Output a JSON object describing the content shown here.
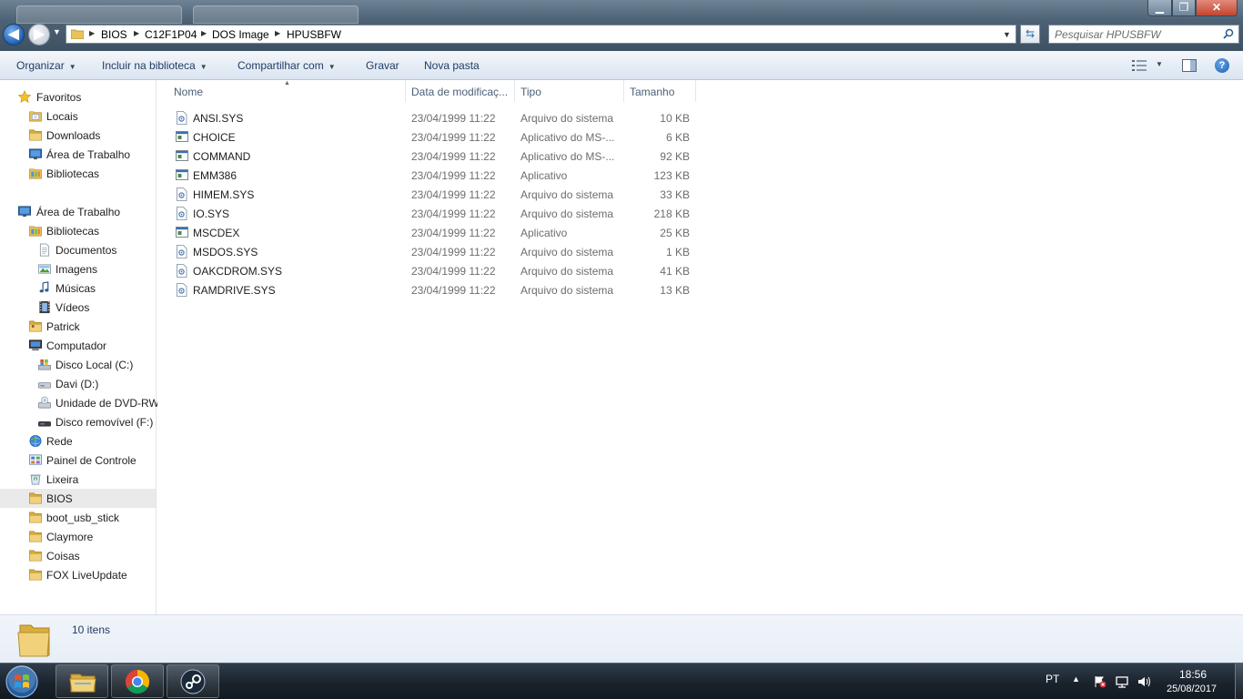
{
  "window": {
    "minimize_glyph": "▁",
    "maximize_glyph": "❐",
    "close_glyph": "✕"
  },
  "address": {
    "breadcrumbs": [
      "BIOS",
      "C12F1P04",
      "DOS Image",
      "HPUSBFW"
    ],
    "search_placeholder": "Pesquisar HPUSBFW"
  },
  "toolbar": {
    "organize": "Organizar",
    "include_in_library": "Incluir na biblioteca",
    "share_with": "Compartilhar com",
    "burn": "Gravar",
    "new_folder": "Nova pasta"
  },
  "nav": {
    "items": [
      {
        "label": "Favoritos",
        "icon": "star-icon"
      },
      {
        "label": "Locais",
        "icon": "recent-places-icon"
      },
      {
        "label": "Downloads",
        "icon": "folder-icon"
      },
      {
        "label": "Área de Trabalho",
        "icon": "desktop-icon"
      },
      {
        "label": "Bibliotecas",
        "icon": "libraries-icon"
      },
      {
        "label": "Área de Trabalho",
        "icon": "desktop-icon"
      },
      {
        "label": "Bibliotecas",
        "icon": "libraries-icon"
      },
      {
        "label": "Documentos",
        "icon": "documents-icon"
      },
      {
        "label": "Imagens",
        "icon": "pictures-icon"
      },
      {
        "label": "Músicas",
        "icon": "music-icon"
      },
      {
        "label": "Vídeos",
        "icon": "videos-icon"
      },
      {
        "label": "Patrick",
        "icon": "user-folder-icon"
      },
      {
        "label": "Computador",
        "icon": "computer-icon"
      },
      {
        "label": "Disco Local (C:)",
        "icon": "local-disk-icon"
      },
      {
        "label": "Davi (D:)",
        "icon": "drive-icon"
      },
      {
        "label": "Unidade de DVD-RW",
        "icon": "dvd-drive-icon"
      },
      {
        "label": "Disco removível (F:)",
        "icon": "removable-drive-icon"
      },
      {
        "label": "Rede",
        "icon": "network-icon"
      },
      {
        "label": "Painel de Controle",
        "icon": "control-panel-icon"
      },
      {
        "label": "Lixeira",
        "icon": "recycle-bin-icon"
      },
      {
        "label": "BIOS",
        "icon": "folder-icon"
      },
      {
        "label": "boot_usb_stick",
        "icon": "folder-icon"
      },
      {
        "label": "Claymore",
        "icon": "folder-icon"
      },
      {
        "label": "Coisas",
        "icon": "folder-icon"
      },
      {
        "label": "FOX LiveUpdate",
        "icon": "folder-icon"
      }
    ]
  },
  "columns": {
    "name": "Nome",
    "date": "Data de modificaç...",
    "type": "Tipo",
    "size": "Tamanho"
  },
  "files": [
    {
      "name": "ANSI.SYS",
      "date": "23/04/1999 11:22",
      "type": "Arquivo do sistema",
      "size": "10 KB",
      "icon": "system-file-icon"
    },
    {
      "name": "CHOICE",
      "date": "23/04/1999 11:22",
      "type": "Aplicativo do MS-...",
      "size": "6 KB",
      "icon": "application-icon"
    },
    {
      "name": "COMMAND",
      "date": "23/04/1999 11:22",
      "type": "Aplicativo do MS-...",
      "size": "92 KB",
      "icon": "application-icon"
    },
    {
      "name": "EMM386",
      "date": "23/04/1999 11:22",
      "type": "Aplicativo",
      "size": "123 KB",
      "icon": "application-icon"
    },
    {
      "name": "HIMEM.SYS",
      "date": "23/04/1999 11:22",
      "type": "Arquivo do sistema",
      "size": "33 KB",
      "icon": "system-file-icon"
    },
    {
      "name": "IO.SYS",
      "date": "23/04/1999 11:22",
      "type": "Arquivo do sistema",
      "size": "218 KB",
      "icon": "system-file-icon"
    },
    {
      "name": "MSCDEX",
      "date": "23/04/1999 11:22",
      "type": "Aplicativo",
      "size": "25 KB",
      "icon": "application-icon"
    },
    {
      "name": "MSDOS.SYS",
      "date": "23/04/1999 11:22",
      "type": "Arquivo do sistema",
      "size": "1 KB",
      "icon": "system-file-icon"
    },
    {
      "name": "OAKCDROM.SYS",
      "date": "23/04/1999 11:22",
      "type": "Arquivo do sistema",
      "size": "41 KB",
      "icon": "system-file-icon"
    },
    {
      "name": "RAMDRIVE.SYS",
      "date": "23/04/1999 11:22",
      "type": "Arquivo do sistema",
      "size": "13 KB",
      "icon": "system-file-icon"
    }
  ],
  "details": {
    "item_count": "10 itens"
  },
  "taskbar": {
    "pinned": [
      "windows-explorer-icon",
      "chrome-icon",
      "steam-icon"
    ],
    "language": "PT",
    "time": "18:56",
    "date": "25/08/2017"
  },
  "colors": {
    "titlebar": "#4e6275",
    "toolbar": "#e6edf6",
    "selection": "#eaeaea",
    "folder": "#e8c25a",
    "accent": "#1d5fb3"
  }
}
